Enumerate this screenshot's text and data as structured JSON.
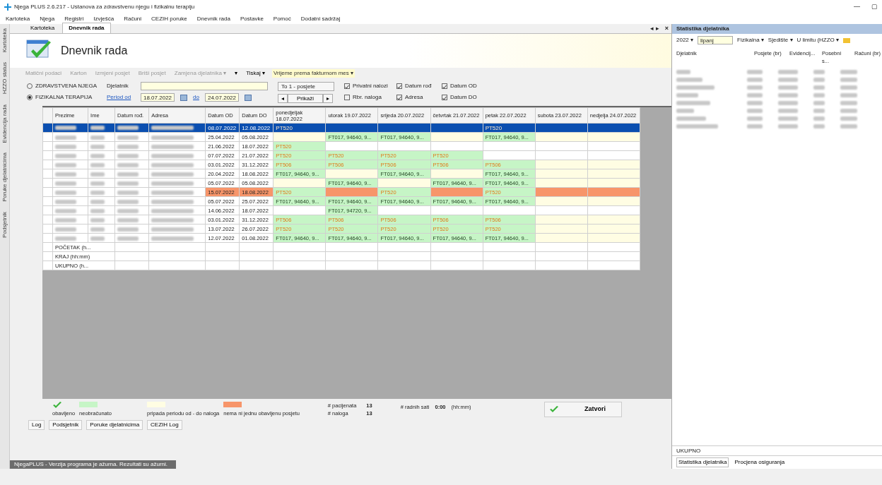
{
  "window": {
    "title": "Njega PLUS 2.6.217 - Ustanova za zdravstvenu njegu i fizikalnu terapiju",
    "controls": [
      "—",
      "▢"
    ]
  },
  "menu": [
    "Kartoteka",
    "Njega",
    "Registri",
    "Izvješća",
    "Računi",
    "CEZIH poruke",
    "Dnevnik rada",
    "Postavke",
    "Pomoć",
    "Dodatni sadržaj"
  ],
  "side_tabs": [
    "Kartoteka",
    "HZZO status",
    "Evidencija rada",
    "Poruke djelatnicima",
    "Podsjetnik"
  ],
  "doc_tabs": [
    {
      "label": "Kartoteka",
      "selected": false
    },
    {
      "label": "Dnevnik rada",
      "selected": true
    }
  ],
  "doc_tab_controls": [
    "◂ ▸",
    "×"
  ],
  "header": {
    "title": "Dnevnik rada"
  },
  "toolbar": [
    {
      "label": "Matični podaci",
      "disabled": true
    },
    {
      "label": "Karton",
      "disabled": true
    },
    {
      "label": "Izmjeni posjet",
      "disabled": true
    },
    {
      "label": "Briši posjet",
      "disabled": true
    },
    {
      "label": "Zamjena djelatnika ▾",
      "disabled": true
    },
    {
      "label": "▾",
      "disabled": false
    },
    {
      "label": "Tiskaj ▾",
      "disabled": false
    },
    {
      "label": "Vrijeme prema fakturnom mes ▾",
      "disabled": false
    }
  ],
  "filters": {
    "types": [
      {
        "label": "ZDRAVSTVENA NJEGA",
        "selected": false
      },
      {
        "label": "FIZIKALNA TERAPIJA",
        "selected": true
      }
    ],
    "employee_label": "Djelatnik",
    "period_label": "Period od",
    "date_from": "18.07.2022",
    "to_label": "do",
    "date_to": "24.07.2022",
    "mode": "To 1 - posjete",
    "prev": "◂",
    "show": "Prikaži",
    "next": "▸",
    "options": [
      {
        "label": "Privatni nalozi",
        "checked": true
      },
      {
        "label": "Datum rođ",
        "checked": true
      },
      {
        "label": "Datum OD",
        "checked": true
      },
      {
        "label": "Rbr. naloga",
        "checked": false
      },
      {
        "label": "Adresa",
        "checked": true
      },
      {
        "label": "Datum DO",
        "checked": true
      }
    ]
  },
  "table": {
    "columns": [
      "Prezime",
      "Ime",
      "Datum rođ.",
      "Adresa",
      "Datum OD",
      "Datum DO",
      "ponedjeljak 18.07.2022",
      "utorak 19.07.2022",
      "srijeda 20.07.2022",
      "četvrtak 21.07.2022",
      "petak 22.07.2022",
      "subota 23.07.2022",
      "nedjelja 24.07.2022"
    ],
    "rows": [
      {
        "selected": true,
        "missing": false,
        "from": "08.07.2022",
        "to": "12.08.2022",
        "days": [
          {
            "text": "PT520",
            "kind": "done",
            "billed": false
          },
          {
            "kind": "pending"
          },
          {
            "kind": "pending"
          },
          {
            "kind": "pending"
          },
          {
            "text": "PT520",
            "kind": "done",
            "billed": false
          },
          {
            "kind": "pending"
          },
          {
            "kind": "pending"
          }
        ]
      },
      {
        "selected": false,
        "missing": false,
        "from": "25.04.2022",
        "to": "05.08.2022",
        "days": [
          {
            "kind": "pending"
          },
          {
            "text": "FT017, 94640, 9...",
            "kind": "done",
            "billed": true
          },
          {
            "text": "FT017, 94640, 9...",
            "kind": "done",
            "billed": true
          },
          {
            "kind": "pending"
          },
          {
            "text": "FT017, 94640, 9...",
            "kind": "done",
            "billed": true
          },
          {
            "kind": "pending"
          },
          {
            "kind": "pending"
          }
        ]
      },
      {
        "selected": false,
        "missing": false,
        "from": "21.06.2022",
        "to": "18.07.2022",
        "days": [
          {
            "text": "PT520",
            "kind": "done",
            "billed": false
          },
          {
            "kind": "none"
          },
          {
            "kind": "none"
          },
          {
            "kind": "none"
          },
          {
            "kind": "none"
          },
          {
            "kind": "none"
          },
          {
            "kind": "none"
          }
        ]
      },
      {
        "selected": false,
        "missing": false,
        "from": "07.07.2022",
        "to": "21.07.2022",
        "days": [
          {
            "text": "PT520",
            "kind": "done",
            "billed": false
          },
          {
            "text": "PT520",
            "kind": "done",
            "billed": false
          },
          {
            "text": "PT520",
            "kind": "done",
            "billed": false
          },
          {
            "text": "PT520",
            "kind": "done",
            "billed": false
          },
          {
            "kind": "none"
          },
          {
            "kind": "none"
          },
          {
            "kind": "none"
          }
        ]
      },
      {
        "selected": false,
        "missing": false,
        "from": "03.01.2022",
        "to": "31.12.2022",
        "days": [
          {
            "text": "PT506",
            "kind": "done",
            "billed": false
          },
          {
            "text": "PT506",
            "kind": "done",
            "billed": false
          },
          {
            "text": "PT506",
            "kind": "done",
            "billed": false
          },
          {
            "text": "PT506",
            "kind": "done",
            "billed": false
          },
          {
            "text": "PT506",
            "kind": "done",
            "billed": false
          },
          {
            "kind": "pending"
          },
          {
            "kind": "pending"
          }
        ]
      },
      {
        "selected": false,
        "missing": false,
        "from": "20.04.2022",
        "to": "18.08.2022",
        "days": [
          {
            "text": "FT017, 94640, 9...",
            "kind": "done",
            "billed": true
          },
          {
            "kind": "pending"
          },
          {
            "text": "FT017, 94640, 9...",
            "kind": "done",
            "billed": true
          },
          {
            "kind": "pending"
          },
          {
            "text": "FT017, 94640, 9...",
            "kind": "done",
            "billed": true
          },
          {
            "kind": "pending"
          },
          {
            "kind": "pending"
          }
        ]
      },
      {
        "selected": false,
        "missing": false,
        "from": "05.07.2022",
        "to": "05.08.2022",
        "days": [
          {
            "kind": "pending"
          },
          {
            "text": "FT017, 94640, 9...",
            "kind": "done",
            "billed": true
          },
          {
            "kind": "pending"
          },
          {
            "text": "FT017, 94640, 9...",
            "kind": "done",
            "billed": true
          },
          {
            "text": "FT017, 94640, 9...",
            "kind": "done",
            "billed": true
          },
          {
            "kind": "pending"
          },
          {
            "kind": "pending"
          }
        ]
      },
      {
        "selected": false,
        "missing": true,
        "from": "15.07.2022",
        "to": "18.08.2022",
        "days": [
          {
            "text": "PT520",
            "kind": "done",
            "billed": false
          },
          {
            "kind": "missing"
          },
          {
            "text": "PT520",
            "kind": "done",
            "billed": false
          },
          {
            "kind": "missing"
          },
          {
            "text": "PT520",
            "kind": "done",
            "billed": false
          },
          {
            "kind": "missing"
          },
          {
            "kind": "missing"
          }
        ]
      },
      {
        "selected": false,
        "missing": false,
        "from": "05.07.2022",
        "to": "25.07.2022",
        "days": [
          {
            "text": "FT017, 94640, 9...",
            "kind": "done",
            "billed": true
          },
          {
            "text": "FT017, 94640, 9...",
            "kind": "done",
            "billed": true
          },
          {
            "text": "FT017, 94640, 9...",
            "kind": "done",
            "billed": true
          },
          {
            "text": "FT017, 94640, 9...",
            "kind": "done",
            "billed": true
          },
          {
            "text": "FT017, 94640, 9...",
            "kind": "done",
            "billed": true
          },
          {
            "kind": "pending"
          },
          {
            "kind": "pending"
          }
        ]
      },
      {
        "selected": false,
        "missing": false,
        "from": "14.06.2022",
        "to": "18.07.2022",
        "days": [
          {
            "kind": "none"
          },
          {
            "text": "FT017, 94720, 9...",
            "kind": "done",
            "billed": true
          },
          {
            "kind": "none"
          },
          {
            "kind": "none"
          },
          {
            "kind": "none"
          },
          {
            "kind": "none"
          },
          {
            "kind": "none"
          }
        ]
      },
      {
        "selected": false,
        "missing": false,
        "from": "03.01.2022",
        "to": "31.12.2022",
        "days": [
          {
            "text": "PT506",
            "kind": "done",
            "billed": false
          },
          {
            "text": "PT506",
            "kind": "done",
            "billed": false
          },
          {
            "text": "PT506",
            "kind": "done",
            "billed": false
          },
          {
            "text": "PT506",
            "kind": "done",
            "billed": false
          },
          {
            "text": "PT506",
            "kind": "done",
            "billed": false
          },
          {
            "kind": "pending"
          },
          {
            "kind": "pending"
          }
        ]
      },
      {
        "selected": false,
        "missing": false,
        "from": "13.07.2022",
        "to": "26.07.2022",
        "days": [
          {
            "text": "PT520",
            "kind": "done",
            "billed": false
          },
          {
            "text": "PT520",
            "kind": "done",
            "billed": false
          },
          {
            "text": "PT520",
            "kind": "done",
            "billed": false
          },
          {
            "text": "PT520",
            "kind": "done",
            "billed": false
          },
          {
            "text": "PT520",
            "kind": "done",
            "billed": false
          },
          {
            "kind": "pending"
          },
          {
            "kind": "pending"
          }
        ]
      },
      {
        "selected": false,
        "missing": false,
        "from": "12.07.2022",
        "to": "01.08.2022",
        "days": [
          {
            "text": "FT017, 94640, 9...",
            "kind": "done",
            "billed": true
          },
          {
            "text": "FT017, 94640, 9...",
            "kind": "done",
            "billed": true
          },
          {
            "text": "FT017, 94640, 9...",
            "kind": "done",
            "billed": true
          },
          {
            "text": "FT017, 94640, 9...",
            "kind": "done",
            "billed": true
          },
          {
            "text": "FT017, 94640, 9...",
            "kind": "done",
            "billed": true
          },
          {
            "kind": "pending"
          },
          {
            "kind": "pending"
          }
        ]
      }
    ],
    "footer_rows": [
      "POČETAK (h...",
      "KRAJ (hh:mm)",
      "UKUPNO (h..."
    ]
  },
  "legend": [
    {
      "label": "obavljeno",
      "kind": "check"
    },
    {
      "label": "neobračunato",
      "kind": "done"
    },
    {
      "label": "pripada periodu od - do naloga",
      "kind": "pending"
    },
    {
      "label": "nema ni jednu obavljenu posjetu",
      "kind": "missing"
    }
  ],
  "stats": [
    {
      "label": "# pacijenata",
      "value": "13"
    },
    {
      "label": "# naloga",
      "value": "13"
    }
  ],
  "hours": {
    "label": "# radnih sati",
    "value": "0:00",
    "unit": "(hh:mm)"
  },
  "close_button": "Zatvori",
  "bottom_tabs": [
    "Log",
    "Podsjetnik",
    "Poruke djelatnicima",
    "CEZIH Log"
  ],
  "status_bar": "NjegaPLUS - Verzija programa je ažurna. Rezultati su ažurni.",
  "right_panel": {
    "title": "Statistika djelatnika",
    "year": "2022 ▾",
    "month": "lipanj",
    "type": "Fizikalna ▾",
    "location": "Sjedište ▾",
    "limit": "U limitu (HZZO ▾",
    "columns": [
      "Djelatnik",
      "Posjete (br)",
      "Evidencij...",
      "Posebni s...",
      "Računi (br)"
    ],
    "total": "UKUPNO",
    "tabs": [
      {
        "label": "Statistika djelatnika",
        "selected": true
      },
      {
        "label": "Procjena osiguranja",
        "selected": false
      }
    ]
  }
}
